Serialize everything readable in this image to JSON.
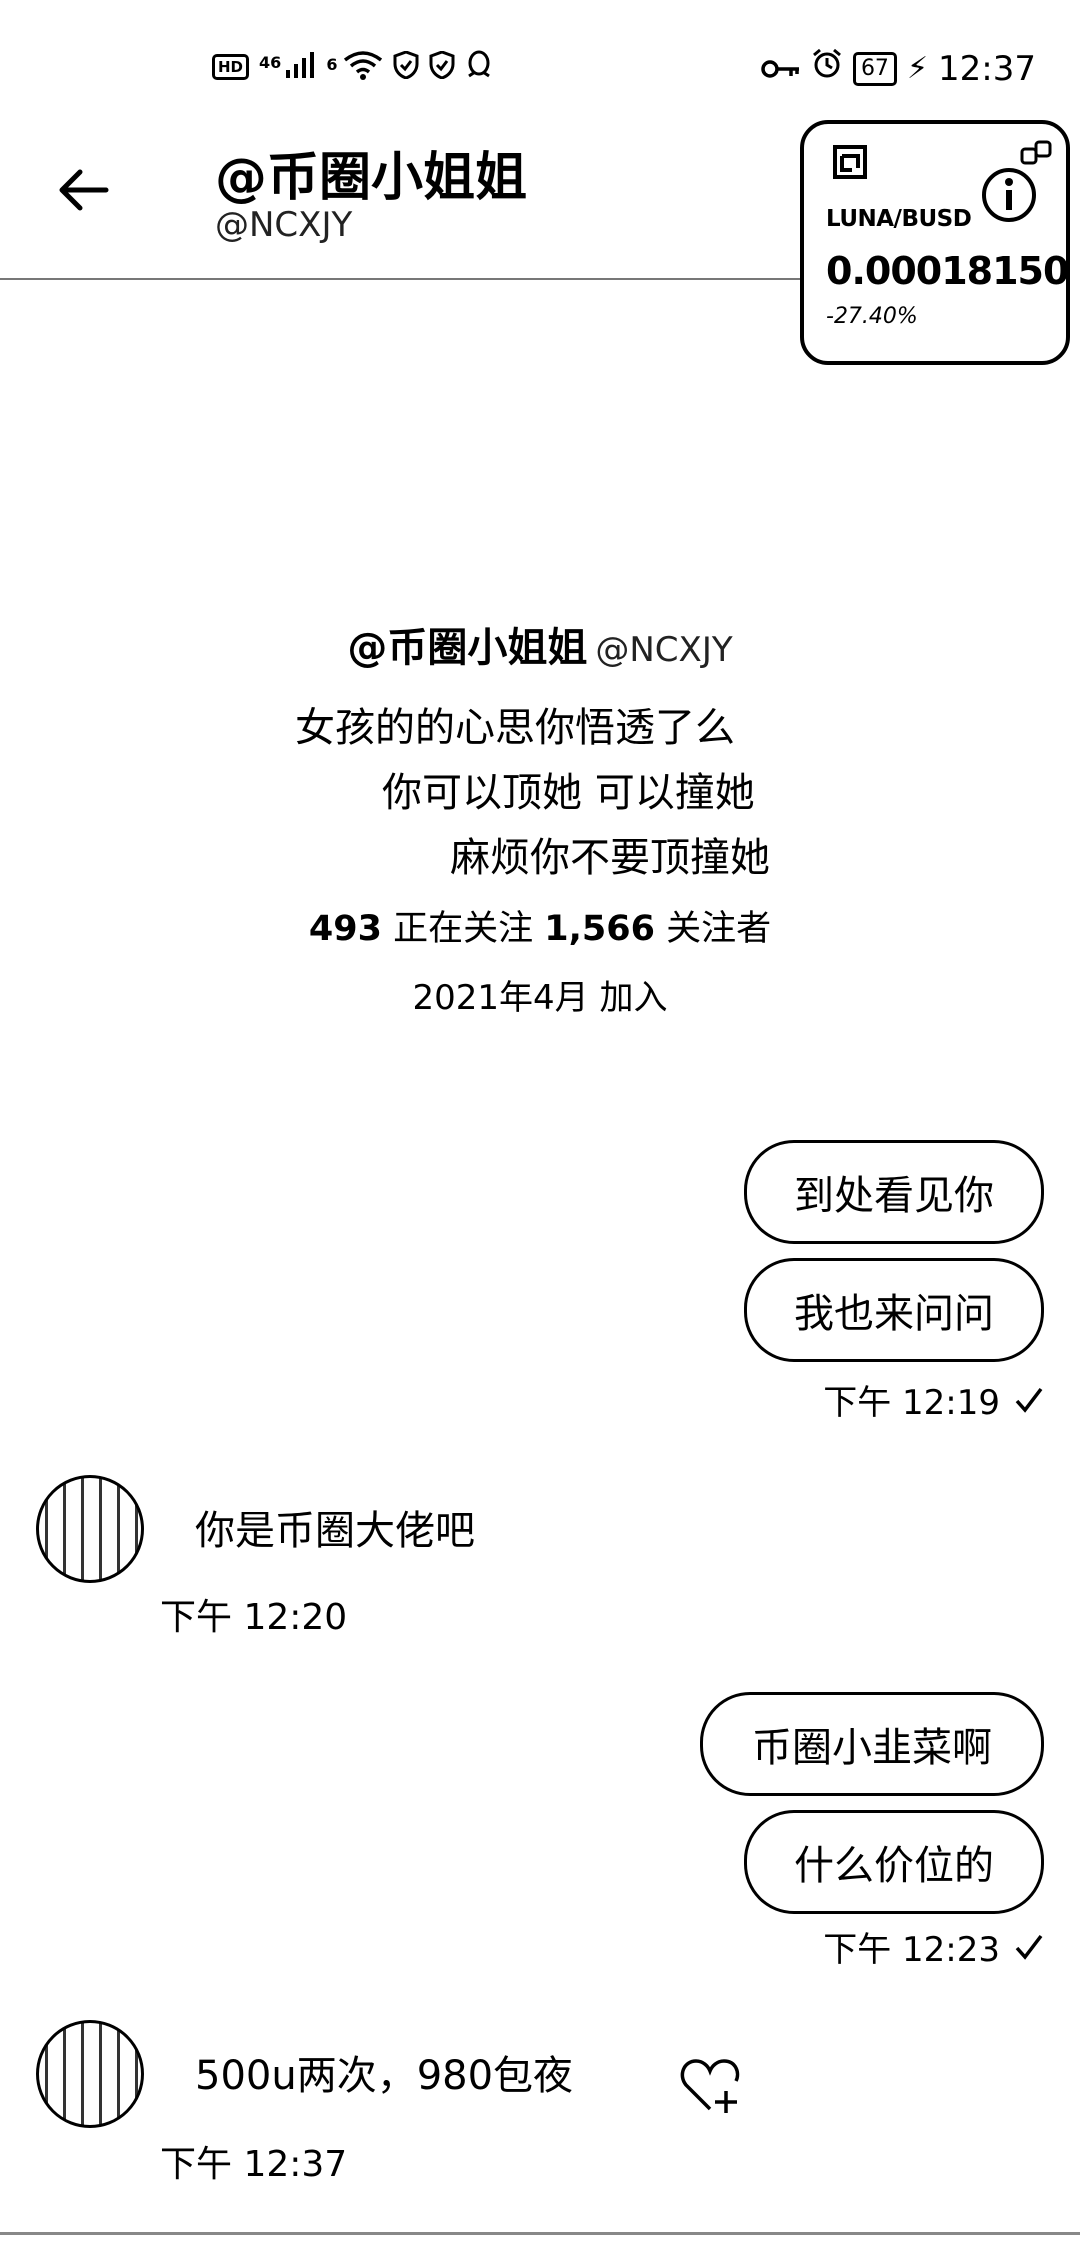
{
  "status_bar": {
    "left_icons": [
      "hd-icon",
      "4g-signal-icon",
      "wifi-icon",
      "shield-icon",
      "shield-icon",
      "qq-icon"
    ],
    "network_label": "46",
    "wifi_label": "6",
    "battery": "67",
    "time": "12:37"
  },
  "header": {
    "title": "@币圈小姐姐",
    "handle": "@NCXJY"
  },
  "widget": {
    "pair": "LUNA/BUSD",
    "price": "0.00018150",
    "change": "-27.40%"
  },
  "profile": {
    "name": "@币圈小姐姐",
    "handle": "@NCXJY",
    "bio_lines": [
      "女孩的的心思你悟透了么",
      "你可以顶她  可以撞她",
      "麻烦你不要顶撞她"
    ],
    "following_count": "493",
    "following_label": "正在关注",
    "followers_count": "1,566",
    "followers_label": "关注者",
    "joined": "2021年4月 加入"
  },
  "messages": [
    {
      "side": "out",
      "text": "到处看见你"
    },
    {
      "side": "out",
      "text": "我也来问问"
    },
    {
      "side": "out_time",
      "text": "下午 12:19"
    },
    {
      "side": "in",
      "text": "你是币圈大佬吧"
    },
    {
      "side": "in_time",
      "text": "下午 12:20"
    },
    {
      "side": "out",
      "text": "币圈小韭菜啊"
    },
    {
      "side": "out",
      "text": "什么价位的"
    },
    {
      "side": "out_time",
      "text": "下午 12:23"
    },
    {
      "side": "in",
      "text": "500u两次，980包夜"
    },
    {
      "side": "in_time",
      "text": "下午 12:37"
    }
  ]
}
